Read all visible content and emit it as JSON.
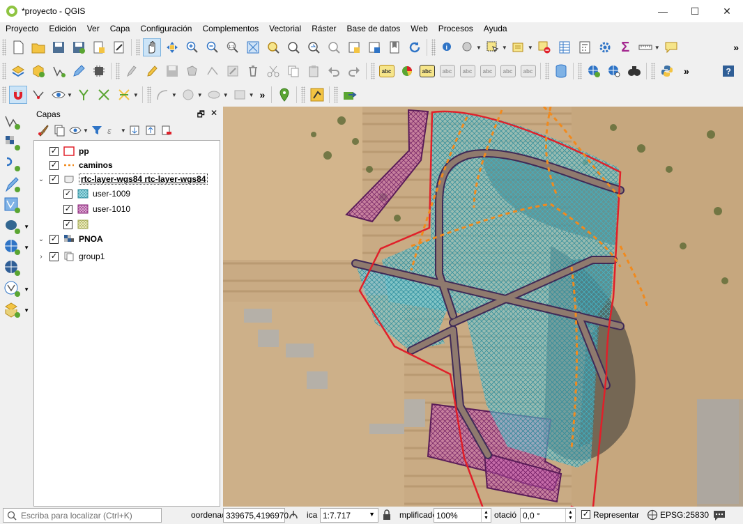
{
  "window": {
    "title": "*proyecto - QGIS",
    "controls": {
      "minimize": "—",
      "maximize": "☐",
      "close": "✕"
    }
  },
  "menu": [
    "Proyecto",
    "Edición",
    "Ver",
    "Capa",
    "Configuración",
    "Complementos",
    "Vectorial",
    "Ráster",
    "Base de datos",
    "Web",
    "Procesos",
    "Ayuda"
  ],
  "toolbar_labels": {
    "abc": "abc",
    "more": "»"
  },
  "layers_panel": {
    "title": "Capas",
    "undock": "🗗",
    "close": "✕",
    "layers": [
      {
        "name": "pp",
        "checked": true,
        "bold": true
      },
      {
        "name": "caminos",
        "checked": true,
        "bold": true
      },
      {
        "name": "rtc-layer-wgs84 rtc-layer-wgs84",
        "checked": true,
        "bold": true,
        "expanded": true
      },
      {
        "name": "user-1009",
        "checked": true,
        "bold": false
      },
      {
        "name": "user-1010",
        "checked": true,
        "bold": false
      },
      {
        "name": "",
        "checked": true,
        "bold": false
      },
      {
        "name": "PNOA",
        "checked": true,
        "bold": true,
        "expanded": true
      },
      {
        "name": "group1",
        "checked": true,
        "bold": false,
        "expanded": false
      }
    ]
  },
  "statusbar": {
    "locator_placeholder": "Escriba para localizar (Ctrl+K)",
    "coord_label": "oordenac",
    "coord_value": "339675,4196970",
    "scale_label": "ica",
    "scale_value": "1:7.717",
    "magnifier_label": "mplificadc",
    "magnifier_value": "100%",
    "rotation_label": "otació",
    "rotation_value": "0,0 °",
    "render_label": "Representar",
    "render_checked": true,
    "crs": "EPSG:25830"
  },
  "colors": {
    "pp_outline": "#e0202a",
    "caminos": "#f08a1e",
    "user1009": "#4fc6d9",
    "user1010": "#b0309a",
    "roads": "#3f2a57"
  }
}
